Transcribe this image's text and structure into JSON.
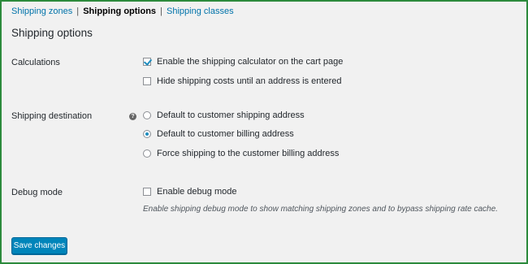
{
  "subnav": {
    "items": [
      {
        "label": "Shipping zones",
        "current": false
      },
      {
        "label": "Shipping options",
        "current": true
      },
      {
        "label": "Shipping classes",
        "current": false
      }
    ],
    "separator": "|"
  },
  "page": {
    "title": "Shipping options"
  },
  "calculations": {
    "label": "Calculations",
    "options": [
      {
        "label": "Enable the shipping calculator on the cart page",
        "checked": true
      },
      {
        "label": "Hide shipping costs until an address is entered",
        "checked": false
      }
    ]
  },
  "destination": {
    "label": "Shipping destination",
    "help_icon": "question-mark-icon",
    "help_glyph": "?",
    "options": [
      {
        "label": "Default to customer shipping address",
        "checked": false
      },
      {
        "label": "Default to customer billing address",
        "checked": true
      },
      {
        "label": "Force shipping to the customer billing address",
        "checked": false
      }
    ]
  },
  "debug": {
    "label": "Debug mode",
    "option": {
      "label": "Enable debug mode",
      "checked": false
    },
    "description": "Enable shipping debug mode to show matching shipping zones and to bypass shipping rate cache."
  },
  "actions": {
    "save_label": "Save changes"
  },
  "colors": {
    "link": "#0073aa",
    "primary_button": "#0085ba",
    "frame_border": "#2c8a3c",
    "background": "#f1f1f1",
    "check": "#1e8cbe"
  }
}
